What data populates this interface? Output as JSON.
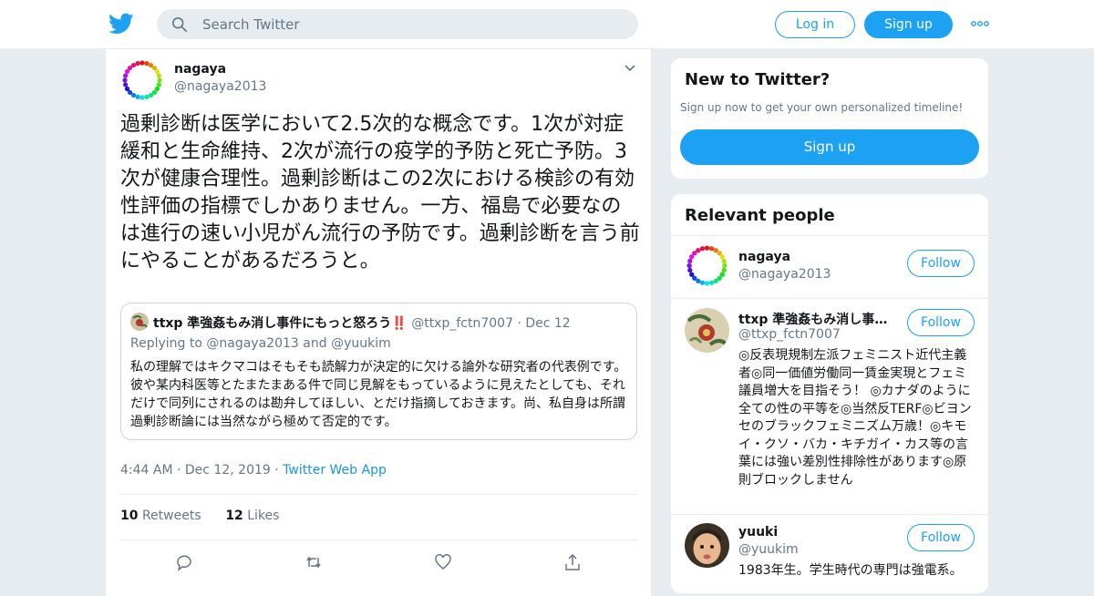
{
  "header": {
    "search_placeholder": "Search Twitter",
    "login_label": "Log in",
    "signup_label": "Sign up",
    "brand_color": "#1da1f2"
  },
  "tweet": {
    "author_name": "nagaya",
    "author_handle": "@nagaya2013",
    "text": "過剰診断は医学において2.5次的な概念です。1次が対症緩和と生命維持、2次が流行の疫学的予防と死亡予防。3次が健康合理性。過剰診断はこの2次における検診の有効性評価の指標でしかありません。一方、福島で必要なのは進行の速い小児がん流行の予防です。過剰診断を言う前にやることがあるだろうと。",
    "quoted": {
      "author_name": "ttxp 準強姦もみ消し事件にもっと怒ろう‼️",
      "author_handle": "@ttxp_fctn7007",
      "separator": "·",
      "date": "Dec 12",
      "replying_prefix": "Replying to",
      "replying_to_1": "@nagaya2013",
      "replying_and": "and",
      "replying_to_2": "@yuukim",
      "text": "私の理解ではキクマコはそもそも読解力が決定的に欠ける論外な研究者の代表例です。彼や某内科医等とたまたまある件で同じ見解をもっているように見えたとしても、それだけで同列にされるのは勘弁してほしい、とだけ指摘しておきます。尚、私自身は所謂過剰診断論には当然ながら極めて否定的です。"
    },
    "time": "4:44 AM",
    "sep": "·",
    "date": "Dec 12, 2019",
    "source": "Twitter Web App",
    "retweets_count": "10",
    "retweets_label": "Retweets",
    "likes_count": "12",
    "likes_label": "Likes"
  },
  "signup_card": {
    "title": "New to Twitter?",
    "subtitle": "Sign up now to get your own personalized timeline!",
    "button_label": "Sign up"
  },
  "relevant": {
    "title": "Relevant people",
    "people": [
      {
        "name": "nagaya",
        "handle": "@nagaya2013",
        "bio": "",
        "follow_label": "Follow"
      },
      {
        "name": "ttxp 準強姦もみ消し事件にもっと怒ろう‼️",
        "handle": "@ttxp_fctn7007",
        "bio": "◎反表現規制左派フェミニスト近代主義者◎同一価値労働同一賃金実現とフェミ議員増大を目指そう！ ◎カナダのように全ての性の平等を◎当然反TERF◎ビヨンセのブラックフェミニズム万歳！◎キモイ・クソ・バカ・キチガイ・カス等の言葉には強い差別性排除性があります◎原則ブロックしません",
        "follow_label": "Follow"
      },
      {
        "name": "yuuki",
        "handle": "@yuukim",
        "bio": "1983年生。学生時代の専門は強電系。",
        "follow_label": "Follow"
      }
    ]
  }
}
